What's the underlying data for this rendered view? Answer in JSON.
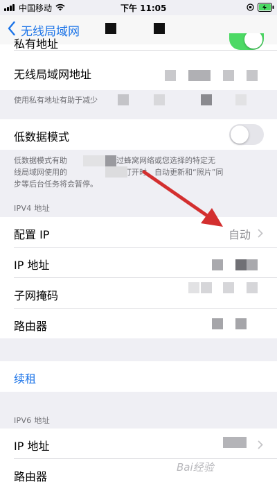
{
  "status_bar": {
    "carrier": "中国移动",
    "time": "下午 11:05"
  },
  "nav": {
    "back_label": "无线局域网"
  },
  "private_address": {
    "label": "私有地址",
    "toggle_on": true
  },
  "wlan_address": {
    "label": "无线局域网地址"
  },
  "private_footer": "使用私有地址有助于减少",
  "low_data": {
    "label": "低数据模式",
    "toggle_on": false,
    "footer_line1_a": "低数据模式有助",
    "footer_line1_b": "通过蜂窝网络或您选择的特定无",
    "footer_line2_a": "线局域网使用的",
    "footer_line2_b": "模式打开时，自动更新和“照片”同",
    "footer_line3": "步等后台任务将会暂停。"
  },
  "ipv4": {
    "header": "IPV4 地址",
    "configure_ip_label": "配置 IP",
    "configure_ip_value": "自动",
    "ip_label": "IP 地址",
    "subnet_label": "子网掩码",
    "router_label": "路由器"
  },
  "renew": {
    "label": "续租"
  },
  "ipv6": {
    "header": "IPV6 地址",
    "ip_label": "IP 地址",
    "router_label": "路由器"
  },
  "colors": {
    "accent": "#1a73e8",
    "toggle_on": "#4cd964",
    "toggle_off": "#e5e5ea",
    "annotation_arrow": "#d32f2f"
  },
  "watermark": "Bai经验"
}
